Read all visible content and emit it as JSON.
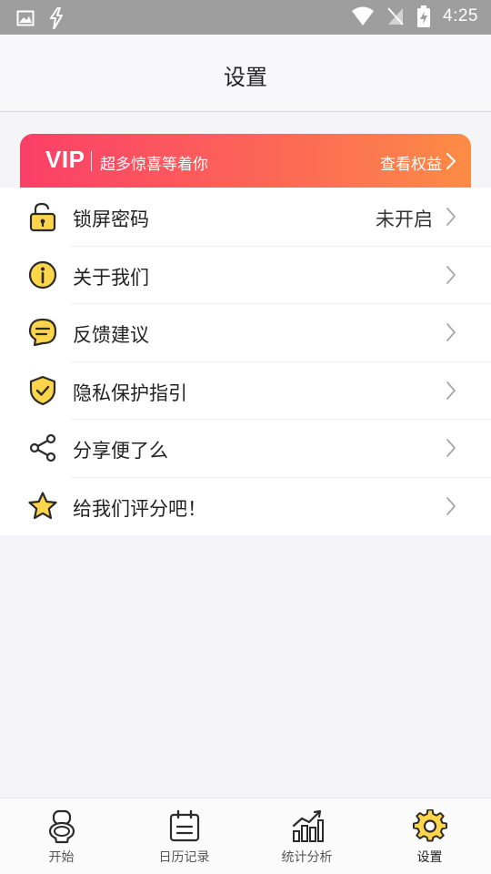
{
  "status_bar": {
    "time": "4:25",
    "icons": [
      "image-icon",
      "bolt-icon",
      "wifi-icon",
      "no-signal-icon",
      "battery-charging-icon"
    ]
  },
  "header": {
    "title": "设置"
  },
  "vip_banner": {
    "mark": "VIP",
    "tagline": "超多惊喜等着你",
    "link_label": "查看权益",
    "gradient_colors": [
      "#fb3f68",
      "#fd8c45"
    ]
  },
  "settings": {
    "items": [
      {
        "label": "锁屏密码",
        "value": "未开启",
        "icon": "unlock-icon"
      },
      {
        "label": "关于我们",
        "value": "",
        "icon": "info-icon"
      },
      {
        "label": "反馈建议",
        "value": "",
        "icon": "message-icon"
      },
      {
        "label": "隐私保护指引",
        "value": "",
        "icon": "shield-check-icon"
      },
      {
        "label": "分享便了么",
        "value": "",
        "icon": "share-icon"
      },
      {
        "label": "给我们评分吧！",
        "value": "",
        "icon": "star-icon"
      }
    ]
  },
  "tab_bar": {
    "active_index": 3,
    "items": [
      {
        "label": "开始",
        "icon": "toilet-icon"
      },
      {
        "label": "日历记录",
        "icon": "calendar-icon"
      },
      {
        "label": "统计分析",
        "icon": "chart-icon"
      },
      {
        "label": "设置",
        "icon": "gear-icon"
      }
    ]
  },
  "colors": {
    "icon_fill": "#fcd54a",
    "icon_stroke": "#2b2b2b",
    "chevron": "#a8a8a8"
  }
}
